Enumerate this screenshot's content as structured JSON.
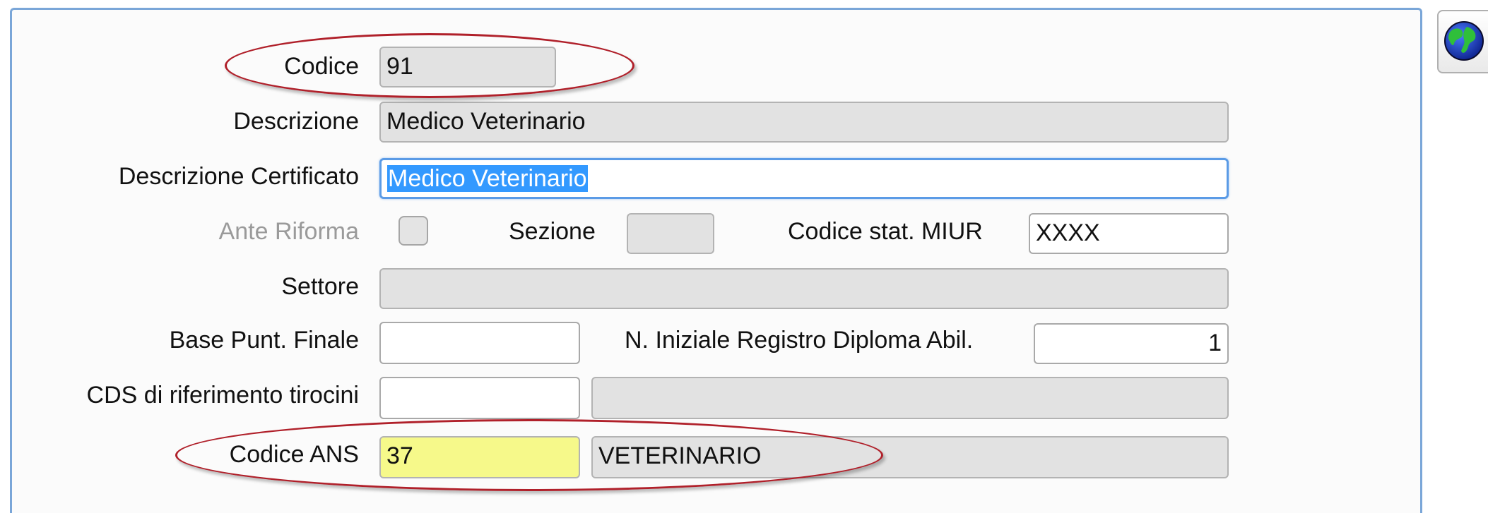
{
  "form": {
    "codice": {
      "label": "Codice",
      "value": "91"
    },
    "descrizione": {
      "label": "Descrizione",
      "value": "Medico Veterinario"
    },
    "descrizione_certificato": {
      "label": "Descrizione Certificato",
      "value": "Medico Veterinario"
    },
    "ante_riforma": {
      "label": "Ante Riforma",
      "checked": false
    },
    "sezione": {
      "label": "Sezione",
      "value": ""
    },
    "codice_stat_miur": {
      "label": "Codice stat. MIUR",
      "value": "XXXX"
    },
    "settore": {
      "label": "Settore",
      "value": ""
    },
    "base_punt_finale": {
      "label": "Base Punt. Finale",
      "value": ""
    },
    "n_iniziale_registro": {
      "label": "N. Iniziale Registro Diploma Abil.",
      "value": "1"
    },
    "cds_riferimento": {
      "label": "CDS di riferimento tirocini",
      "code": "",
      "description": ""
    },
    "codice_ans": {
      "label": "Codice ANS",
      "code": "37",
      "description": "VETERINARIO"
    }
  },
  "toolbar": {
    "globe_icon": "globe-icon"
  },
  "colors": {
    "annotation": "#b0202a",
    "highlight_yellow": "#f6f98a",
    "focus_border": "#5b9be6",
    "selection": "#3399ff"
  }
}
